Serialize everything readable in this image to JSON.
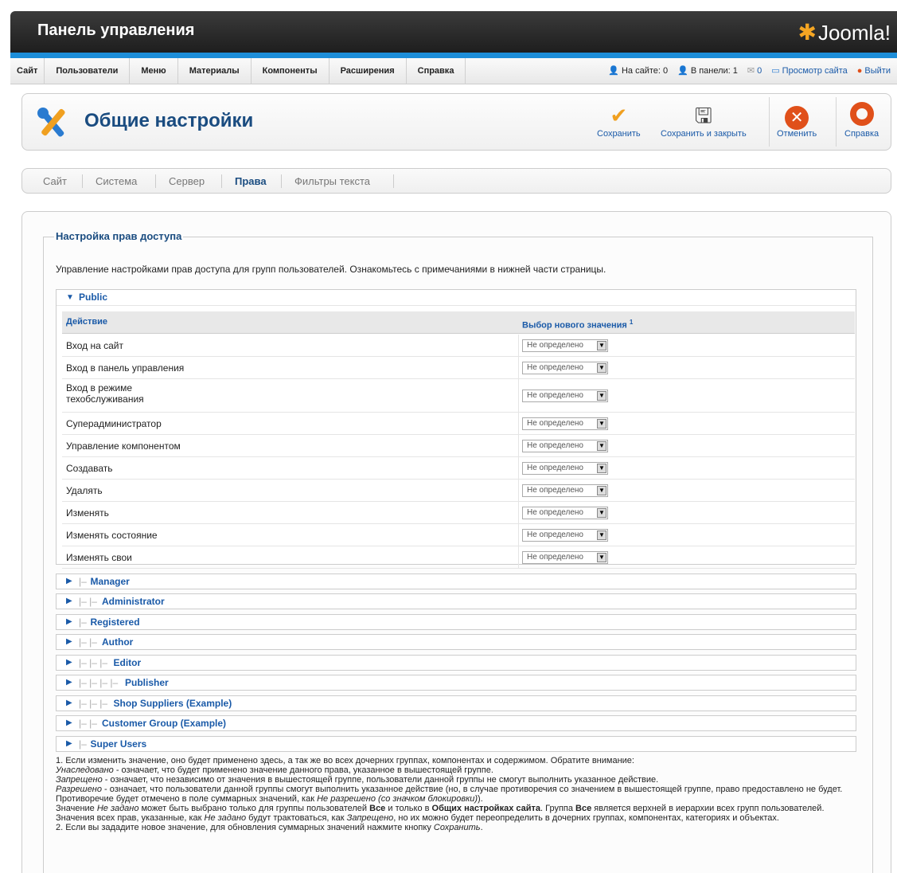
{
  "header": {
    "title": "Панель управления",
    "logo": "Joomla!"
  },
  "menu": [
    "Сайт",
    "Пользователи",
    "Меню",
    "Материалы",
    "Компоненты",
    "Расширения",
    "Справка"
  ],
  "status": {
    "on_site": "На сайте: 0",
    "in_panel": "В панели: 1",
    "messages": "0",
    "view_site": "Просмотр сайта",
    "logout": "Выйти"
  },
  "toolbar": {
    "heading": "Общие настройки",
    "save": "Сохранить",
    "save_close": "Сохранить и закрыть",
    "cancel": "Отменить",
    "help": "Справка"
  },
  "tabs": [
    "Сайт",
    "Система",
    "Сервер",
    "Права",
    "Фильтры текста"
  ],
  "active_tab": "Права",
  "permissions": {
    "legend": "Настройка прав доступа",
    "intro": "Управление настройками прав доступа для групп пользователей. Ознакомьтесь с примечаниями в нижней части страницы.",
    "open_group": "Public",
    "col_action": "Действие",
    "col_value": "Выбор нового значения",
    "col_value_sup": "1",
    "select_value": "Не определено",
    "actions": [
      "Вход на сайт",
      "Вход в панель управления",
      "Вход в режиме техобслуживания",
      "Суперадминистратор",
      "Управление компонентом",
      "Создавать",
      "Удалять",
      "Изменять",
      "Изменять состояние",
      "Изменять свои"
    ],
    "groups": [
      {
        "tree": "|–",
        "name": "Manager"
      },
      {
        "tree": "|– |–",
        "name": "Administrator"
      },
      {
        "tree": "|–",
        "name": "Registered"
      },
      {
        "tree": "|– |–",
        "name": "Author"
      },
      {
        "tree": "|– |– |–",
        "name": "Editor"
      },
      {
        "tree": "|– |– |– |–",
        "name": "Publisher"
      },
      {
        "tree": "|– |– |–",
        "name": "Shop Suppliers (Example)"
      },
      {
        "tree": "|– |–",
        "name": "Customer Group (Example)"
      },
      {
        "tree": "|–",
        "name": "Super Users"
      }
    ]
  },
  "notes": {
    "n1": "1. Если изменить значение, оно будет применено здесь, а так же во всех дочерних группах, компонентах и содержимом. Обратите внимание:",
    "inherited_term": "Унаследовано",
    "inherited_text": " - означает, что будет применено значение данного права, указанное в вышестоящей группе.",
    "denied_term": "Запрещено",
    "denied_text": " - означает, что независимо от значения в вышестоящей группе, пользователи данной группы не смогут выполнить указанное действие.",
    "allowed_term": "Разрешено",
    "allowed_text_a": " - означает, что пользователи данной группы смогут выполнить указанное действие (но, в случае противоречия со значением в вышестоящей группе, право предоставлено не будет. Противоречие будет отмечено в поле суммарных значений, как ",
    "allowed_italic": "Не разрешено (со значком блокировки)",
    "allowed_text_b": ").",
    "notset_a": "Значение ",
    "notset_term": "Не задано",
    "notset_b": " может быть выбрано только для группы пользователей ",
    "all_term": "Все",
    "notset_c": " и только в ",
    "global_term": "Общих настройках сайта",
    "notset_d": ". Группа ",
    "notset_e": " является верхней в иерархии всех групп пользователей. Значения всех прав, указанные, как ",
    "notset_f": " будут трактоваться, как ",
    "notset_g": ", но их можно будет переопределить в дочерних группах, компонентах, категориях и объектах.",
    "n2_a": "2. Если вы зададите новое значение, для обновления суммарных значений нажмите кнопку ",
    "n2_term": "Сохранить",
    "n2_b": "."
  }
}
